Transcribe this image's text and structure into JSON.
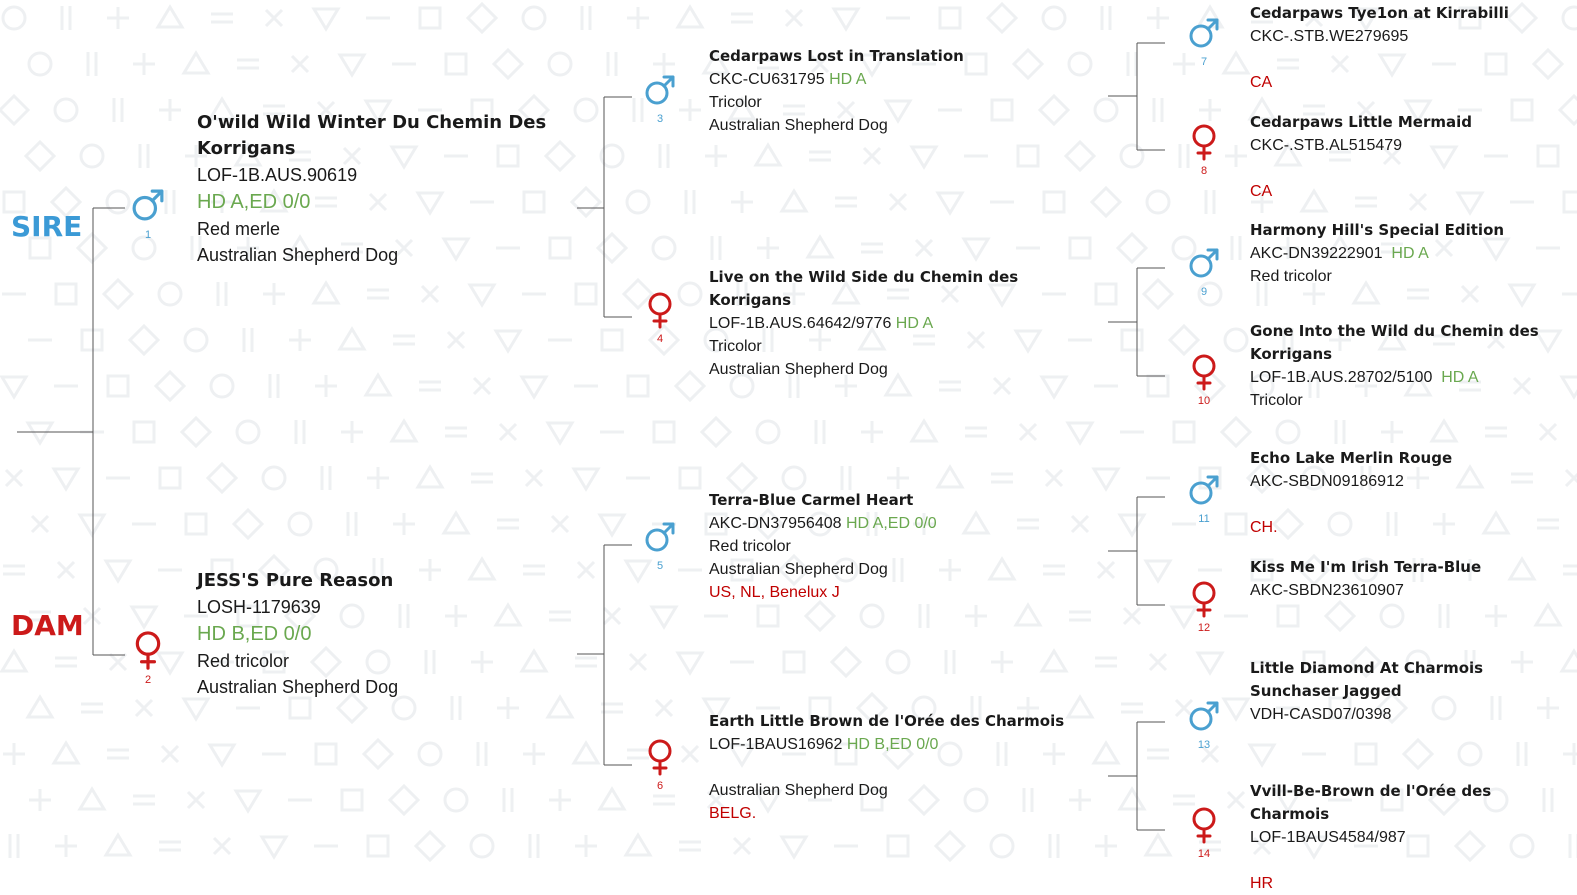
{
  "labels": {
    "sire": "SIRE",
    "dam": "DAM"
  },
  "colors": {
    "male": "#4aa0d0",
    "female": "#cc1a1a",
    "hd": "#6aa84f",
    "titles": "#c00000",
    "line": "#555555"
  },
  "dogs": {
    "d1": {
      "num": "1",
      "sex": "male",
      "name": "O'wild Wild Winter Du Chemin Des Korrigans",
      "reg": "LOF-1B.AUS.90619",
      "hd": "HD A,ED 0/0",
      "color": "Red merle",
      "breed": "Australian Shepherd Dog"
    },
    "d2": {
      "num": "2",
      "sex": "female",
      "name": "JESS'S Pure Reason",
      "reg": "LOSH-1179639",
      "hd": "HD B,ED 0/0",
      "color": "Red tricolor",
      "breed": "Australian Shepherd Dog"
    },
    "d3": {
      "num": "3",
      "sex": "male",
      "name": "Cedarpaws Lost in Translation",
      "reg": "CKC-CU631795",
      "hd": "HD A",
      "color": "Tricolor",
      "breed": "Australian Shepherd Dog"
    },
    "d4": {
      "num": "4",
      "sex": "female",
      "name": "Live on the Wild Side du Chemin des Korrigans",
      "reg": "LOF-1B.AUS.64642/9776",
      "hd": "HD A",
      "color": "Tricolor",
      "breed": "Australian Shepherd Dog"
    },
    "d5": {
      "num": "5",
      "sex": "male",
      "name": "Terra-Blue Carmel Heart",
      "reg": "AKC-DN37956408",
      "hd": "HD A,ED 0/0",
      "color": "Red tricolor",
      "breed": "Australian Shepherd Dog",
      "titles": "US, NL, Benelux J"
    },
    "d6": {
      "num": "6",
      "sex": "female",
      "name": "Earth Little Brown de l'Orée des Charmois",
      "reg": "LOF-1BAUS16962",
      "hd": "HD B,ED 0/0",
      "breed": "Australian Shepherd Dog",
      "titles": "BELG."
    },
    "d7": {
      "num": "7",
      "sex": "male",
      "name": "Cedarpaws Tye1on at Kirrabilli",
      "reg": "CKC-.STB.WE279695",
      "titles": "CA"
    },
    "d8": {
      "num": "8",
      "sex": "female",
      "name": "Cedarpaws Little Mermaid",
      "reg": "CKC-.STB.AL515479",
      "titles": "CA"
    },
    "d9": {
      "num": "9",
      "sex": "male",
      "name": "Harmony Hill's Special Edition",
      "reg": "AKC-DN39222901",
      "hd": "HD A",
      "color": "Red tricolor"
    },
    "d10": {
      "num": "10",
      "sex": "female",
      "name": "Gone Into the Wild du Chemin des Korrigans",
      "reg": "LOF-1B.AUS.28702/5100",
      "hd": "HD A",
      "color": "Tricolor"
    },
    "d11": {
      "num": "11",
      "sex": "male",
      "name": "Echo Lake Merlin Rouge",
      "reg": "AKC-SBDN09186912",
      "titles": "CH."
    },
    "d12": {
      "num": "12",
      "sex": "female",
      "name": "Kiss Me I'm Irish Terra-Blue",
      "reg": "AKC-SBDN23610907"
    },
    "d13": {
      "num": "13",
      "sex": "male",
      "name": "Little Diamond At Charmois Sunchaser Jagged",
      "reg": "VDH-CASD07/0398"
    },
    "d14": {
      "num": "14",
      "sex": "female",
      "name": "Vvill-Be-Brown de l'Orée des Charmois",
      "reg": "LOF-1BAUS4584/987",
      "titles": "HR"
    }
  }
}
